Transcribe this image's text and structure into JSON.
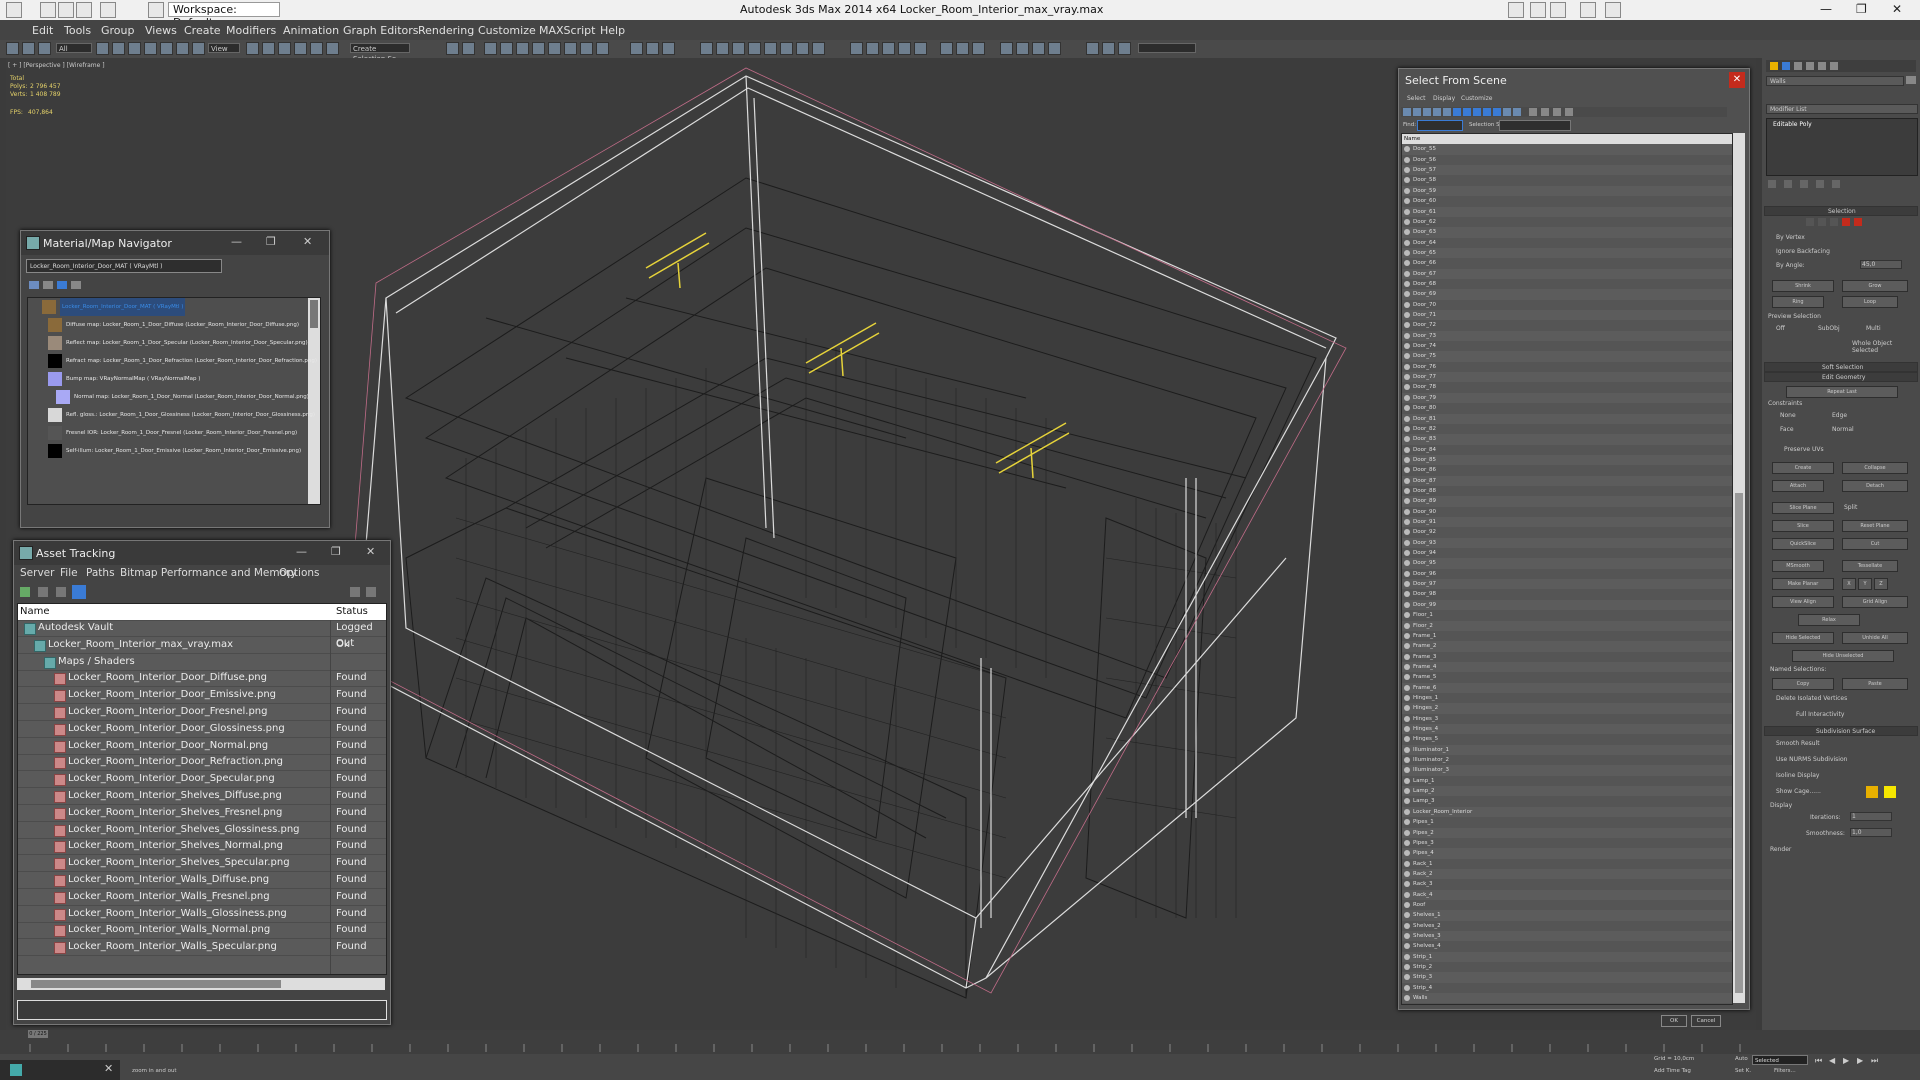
{
  "app": {
    "title": "Autodesk 3ds Max  2014 x64      Locker_Room_Interior_max_vray.max",
    "workspace": "Workspace: Default"
  },
  "menu": [
    "Edit",
    "Tools",
    "Group",
    "Views",
    "Create",
    "Modifiers",
    "Animation",
    "Graph Editors",
    "Rendering",
    "Customize",
    "MAXScript",
    "Help"
  ],
  "toolbar": {
    "filter": "All",
    "view": "View",
    "selection_set": "Create Selection Se"
  },
  "viewport": {
    "label": "[ + ] [Perspective ] [Wireframe ]",
    "stats": {
      "total": "Total",
      "polys_label": "Polys:",
      "polys": "2 796 457",
      "verts_label": "Verts:",
      "verts": "1 408 789",
      "fps_label": "FPS:",
      "fps": "407,864"
    }
  },
  "material_navigator": {
    "title": "Material/Map Navigator",
    "field": "Locker_Room_Interior_Door_MAT ( VRayMtl )",
    "items": [
      {
        "label": "Locker_Room_Interior_Door_MAT ( VRayMtl )",
        "color": "#8a6a3a",
        "selected": true
      },
      {
        "label": "Diffuse map: Locker_Room_1_Door_Diffuse (Locker_Room_Interior_Door_Diffuse.png)",
        "color": "#8a6a3a"
      },
      {
        "label": "Reflect map: Locker_Room_1_Door_Specular (Locker_Room_Interior_Door_Specular.png)",
        "color": "#9a8a7a"
      },
      {
        "label": "Refract map: Locker_Room_1_Door_Refraction (Locker_Room_Interior_Door_Refraction.png)",
        "color": "#000000"
      },
      {
        "label": "Bump map: VRayNormalMap  ( VRayNormalMap )",
        "color": "#9a9aee"
      },
      {
        "label": "Normal map: Locker_Room_1_Door_Normal (Locker_Room_Interior_Door_Normal.png)",
        "color": "#a9a9f5"
      },
      {
        "label": "Refl. gloss.: Locker_Room_1_Door_Glossiness (Locker_Room_Interior_Door_Glossiness.png)",
        "color": "#d8d8d8"
      },
      {
        "label": "Fresnel IOR: Locker_Room_1_Door_Fresnel (Locker_Room_Interior_Door_Fresnel.png)",
        "color": "#555555"
      },
      {
        "label": "Self-illum: Locker_Room_1_Door_Emissive (Locker_Room_Interior_Door_Emissive.png)",
        "color": "#000000"
      }
    ]
  },
  "asset_tracking": {
    "title": "Asset Tracking",
    "menu": [
      "Server",
      "File",
      "Paths",
      "Bitmap Performance and Memory",
      "Options"
    ],
    "columns": [
      "Name",
      "Status"
    ],
    "rows": [
      {
        "name": "Autodesk Vault",
        "status": "Logged Out",
        "level": 0
      },
      {
        "name": "Locker_Room_Interior_max_vray.max",
        "status": "Ok",
        "level": 1
      },
      {
        "name": "Maps / Shaders",
        "status": "",
        "level": 2
      },
      {
        "name": "Locker_Room_Interior_Door_Diffuse.png",
        "status": "Found",
        "level": 3
      },
      {
        "name": "Locker_Room_Interior_Door_Emissive.png",
        "status": "Found",
        "level": 3
      },
      {
        "name": "Locker_Room_Interior_Door_Fresnel.png",
        "status": "Found",
        "level": 3
      },
      {
        "name": "Locker_Room_Interior_Door_Glossiness.png",
        "status": "Found",
        "level": 3
      },
      {
        "name": "Locker_Room_Interior_Door_Normal.png",
        "status": "Found",
        "level": 3
      },
      {
        "name": "Locker_Room_Interior_Door_Refraction.png",
        "status": "Found",
        "level": 3
      },
      {
        "name": "Locker_Room_Interior_Door_Specular.png",
        "status": "Found",
        "level": 3
      },
      {
        "name": "Locker_Room_Interior_Shelves_Diffuse.png",
        "status": "Found",
        "level": 3
      },
      {
        "name": "Locker_Room_Interior_Shelves_Fresnel.png",
        "status": "Found",
        "level": 3
      },
      {
        "name": "Locker_Room_Interior_Shelves_Glossiness.png",
        "status": "Found",
        "level": 3
      },
      {
        "name": "Locker_Room_Interior_Shelves_Normal.png",
        "status": "Found",
        "level": 3
      },
      {
        "name": "Locker_Room_Interior_Shelves_Specular.png",
        "status": "Found",
        "level": 3
      },
      {
        "name": "Locker_Room_Interior_Walls_Diffuse.png",
        "status": "Found",
        "level": 3
      },
      {
        "name": "Locker_Room_Interior_Walls_Fresnel.png",
        "status": "Found",
        "level": 3
      },
      {
        "name": "Locker_Room_Interior_Walls_Glossiness.png",
        "status": "Found",
        "level": 3
      },
      {
        "name": "Locker_Room_Interior_Walls_Normal.png",
        "status": "Found",
        "level": 3
      },
      {
        "name": "Locker_Room_Interior_Walls_Specular.png",
        "status": "Found",
        "level": 3
      }
    ]
  },
  "select_from_scene": {
    "title": "Select From Scene",
    "menu": [
      "Select",
      "Display",
      "Customize"
    ],
    "find_label": "Find:",
    "selection_set_label": "Selection Set:",
    "column": "Name",
    "items": [
      "Door_55",
      "Door_56",
      "Door_57",
      "Door_58",
      "Door_59",
      "Door_60",
      "Door_61",
      "Door_62",
      "Door_63",
      "Door_64",
      "Door_65",
      "Door_66",
      "Door_67",
      "Door_68",
      "Door_69",
      "Door_70",
      "Door_71",
      "Door_72",
      "Door_73",
      "Door_74",
      "Door_75",
      "Door_76",
      "Door_77",
      "Door_78",
      "Door_79",
      "Door_80",
      "Door_81",
      "Door_82",
      "Door_83",
      "Door_84",
      "Door_85",
      "Door_86",
      "Door_87",
      "Door_88",
      "Door_89",
      "Door_90",
      "Door_91",
      "Door_92",
      "Door_93",
      "Door_94",
      "Door_95",
      "Door_96",
      "Door_97",
      "Door_98",
      "Door_99",
      "Floor_1",
      "Floor_2",
      "Frame_1",
      "Frame_2",
      "Frame_3",
      "Frame_4",
      "Frame_5",
      "Frame_6",
      "Hinges_1",
      "Hinges_2",
      "Hinges_3",
      "Hinges_4",
      "Hinges_5",
      "Illuminator_1",
      "Illuminator_2",
      "Illuminator_3",
      "Lamp_1",
      "Lamp_2",
      "Lamp_3",
      "Locker_Room_Interior",
      "Pipes_1",
      "Pipes_2",
      "Pipes_3",
      "Pipes_4",
      "Rack_1",
      "Rack_2",
      "Rack_3",
      "Rack_4",
      "Roof",
      "Shelves_1",
      "Shelves_2",
      "Shelves_3",
      "Shelves_4",
      "Strip_1",
      "Strip_2",
      "Strip_3",
      "Strip_4",
      "Walls"
    ],
    "ok": "OK",
    "cancel": "Cancel"
  },
  "command_panel": {
    "object_name": "Walls",
    "modifier_list": "Modifier List",
    "stack_item": "Editable Poly",
    "selection_header": "Selection",
    "by_vertex": "By Vertex",
    "ignore_backfacing": "Ignore Backfacing",
    "by_angle": "By Angle:",
    "angle_value": "45,0",
    "shrink": "Shrink",
    "grow": "Grow",
    "ring": "Ring",
    "loop": "Loop",
    "preview_selection": "Preview Selection",
    "preview_off": "Off",
    "preview_subobj": "SubObj",
    "preview_multi": "Multi",
    "whole_object": "Whole Object Selected",
    "soft_selection": "Soft Selection",
    "edit_geometry": "Edit Geometry",
    "repeat_last": "Repeat Last",
    "constraints": "Constraints",
    "c_none": "None",
    "c_edge": "Edge",
    "c_face": "Face",
    "c_normal": "Normal",
    "preserve_uvs": "Preserve UVs",
    "create": "Create",
    "collapse": "Collapse",
    "attach": "Attach",
    "detach": "Detach",
    "slice_plane": "Slice Plane",
    "split": "Split",
    "slice": "Slice",
    "reset_plane": "Reset Plane",
    "quickslice": "QuickSlice",
    "cut": "Cut",
    "msmooth": "MSmooth",
    "tessellate": "Tessellate",
    "make_planar": "Make Planar",
    "x": "X",
    "y": "Y",
    "z": "Z",
    "view_align": "View Align",
    "grid_align": "Grid Align",
    "relax": "Relax",
    "hide_selected": "Hide Selected",
    "unhide_all": "Unhide All",
    "hide_unselected": "Hide Unselected",
    "named_selections": "Named Selections:",
    "copy": "Copy",
    "paste": "Paste",
    "delete_isolated": "Delete Isolated Vertices",
    "full_interactivity": "Full Interactivity",
    "subdivision_surface": "Subdivision Surface",
    "smooth_result": "Smooth Result",
    "use_nurms": "Use NURMS Subdivision",
    "isoline_display": "Isoline Display",
    "show_cage": "Show Cage......",
    "display": "Display",
    "iterations": "Iterations:",
    "iterations_value": "1",
    "smoothness": "Smoothness:",
    "smoothness_value": "1,0",
    "render": "Render",
    "cage_color1": "#e8b000",
    "cage_color2": "#f5e600"
  },
  "timeline": {
    "frame": "0 / 225"
  },
  "status": {
    "hint": "zoom in and out",
    "grid": "Grid = 10,0cm",
    "auto": "Auto",
    "selected": "Selected",
    "set_key": "Set K.",
    "key_filters": "Filters...",
    "add_time_tag": "Add Time Tag"
  },
  "colors": {
    "viewport_bg": "#3c3c3c",
    "wire": "#1a1a1a",
    "bbox": "#e0e0e0",
    "light": "#e6d33a",
    "accent_blue": "#3a7bd5"
  }
}
